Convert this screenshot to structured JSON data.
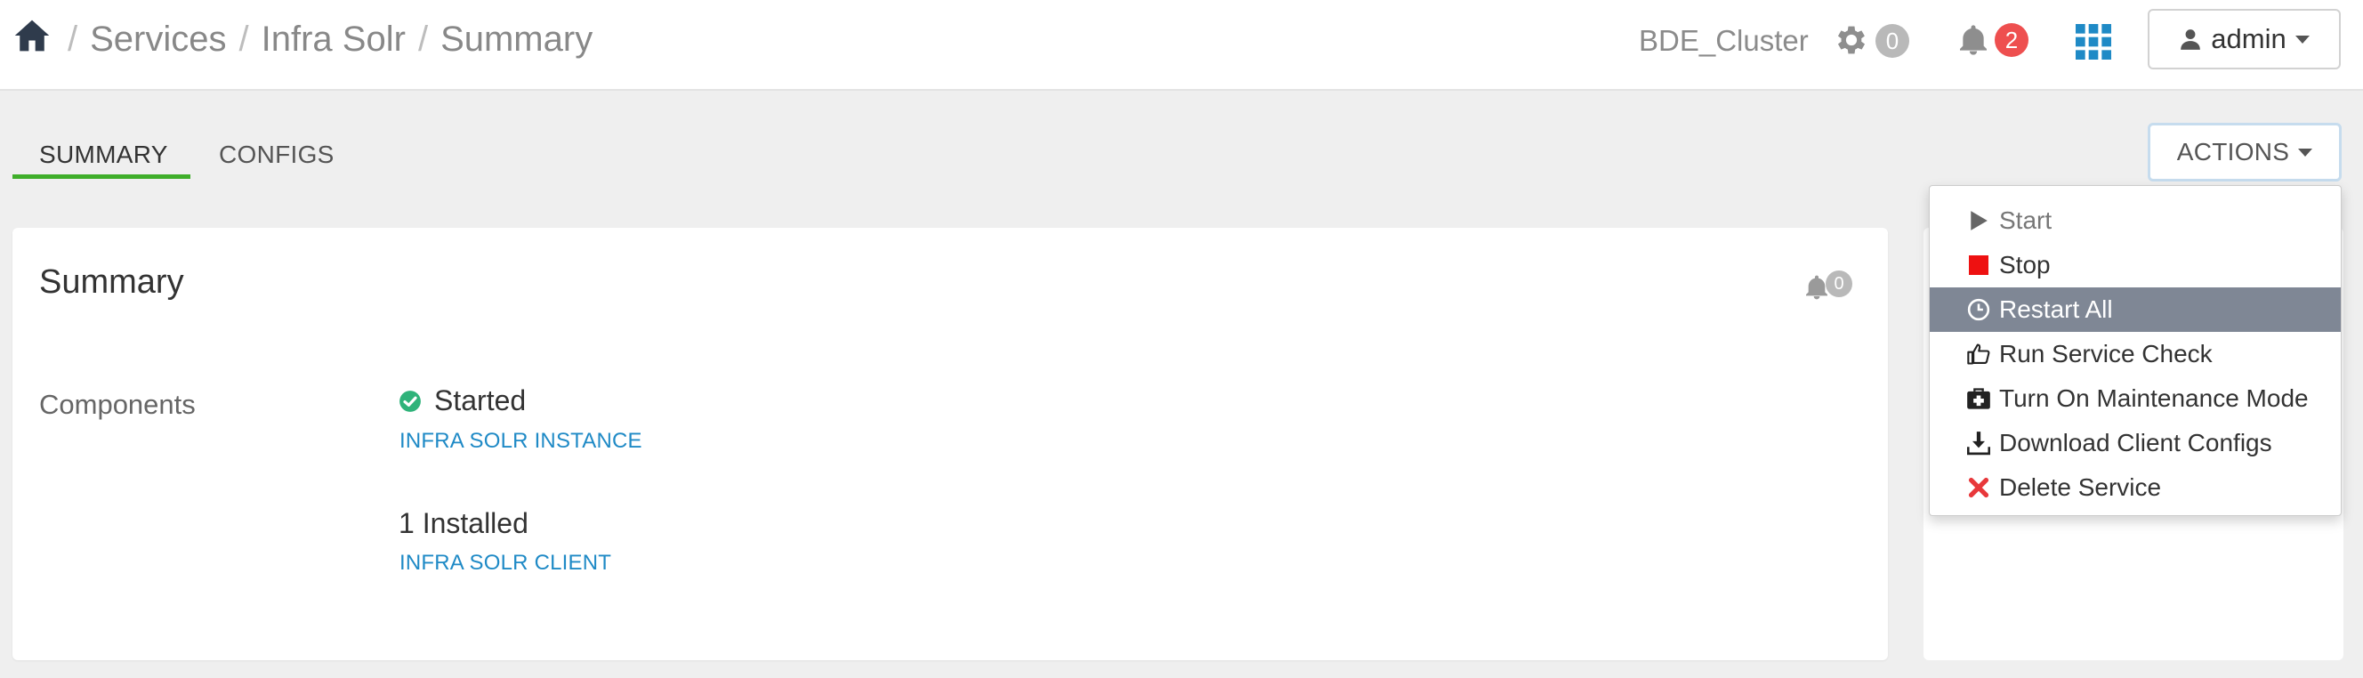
{
  "header": {
    "breadcrumb": [
      "Services",
      "Infra Solr",
      "Summary"
    ],
    "separator": "/",
    "cluster_name": "BDE_Cluster",
    "ops_count": "0",
    "alerts_count": "2",
    "user_label": "admin"
  },
  "tabs": [
    {
      "label": "SUMMARY",
      "active": true
    },
    {
      "label": "CONFIGS",
      "active": false
    }
  ],
  "actions_label": "ACTIONS",
  "summary": {
    "title": "Summary",
    "alerts_count": "0",
    "components_label": "Components",
    "started_status": "Started",
    "started_component": "INFRA SOLR INSTANCE",
    "installed_status": "1 Installed",
    "installed_component": "INFRA SOLR CLIENT"
  },
  "actions_menu": [
    {
      "label": "Start",
      "icon": "play-icon"
    },
    {
      "label": "Stop",
      "icon": "stop-icon"
    },
    {
      "label": "Restart All",
      "icon": "clock-icon"
    },
    {
      "label": "Run Service Check",
      "icon": "thumbs-up-icon"
    },
    {
      "label": "Turn On Maintenance Mode",
      "icon": "medkit-icon"
    },
    {
      "label": "Download Client Configs",
      "icon": "download-icon"
    },
    {
      "label": "Delete Service",
      "icon": "delete-x-icon"
    }
  ],
  "colors": {
    "tab_active_underline": "#3fae2a",
    "alert_badge": "#ee4f4f",
    "ops_badge": "#b9b9b9",
    "link": "#1f8ac6",
    "menu_highlight": "#7f8795",
    "started_green": "#2fb37a",
    "stop_red": "#ee1111",
    "delete_red": "#e8383b",
    "grid_icon_blue": "#1f8ac6"
  }
}
